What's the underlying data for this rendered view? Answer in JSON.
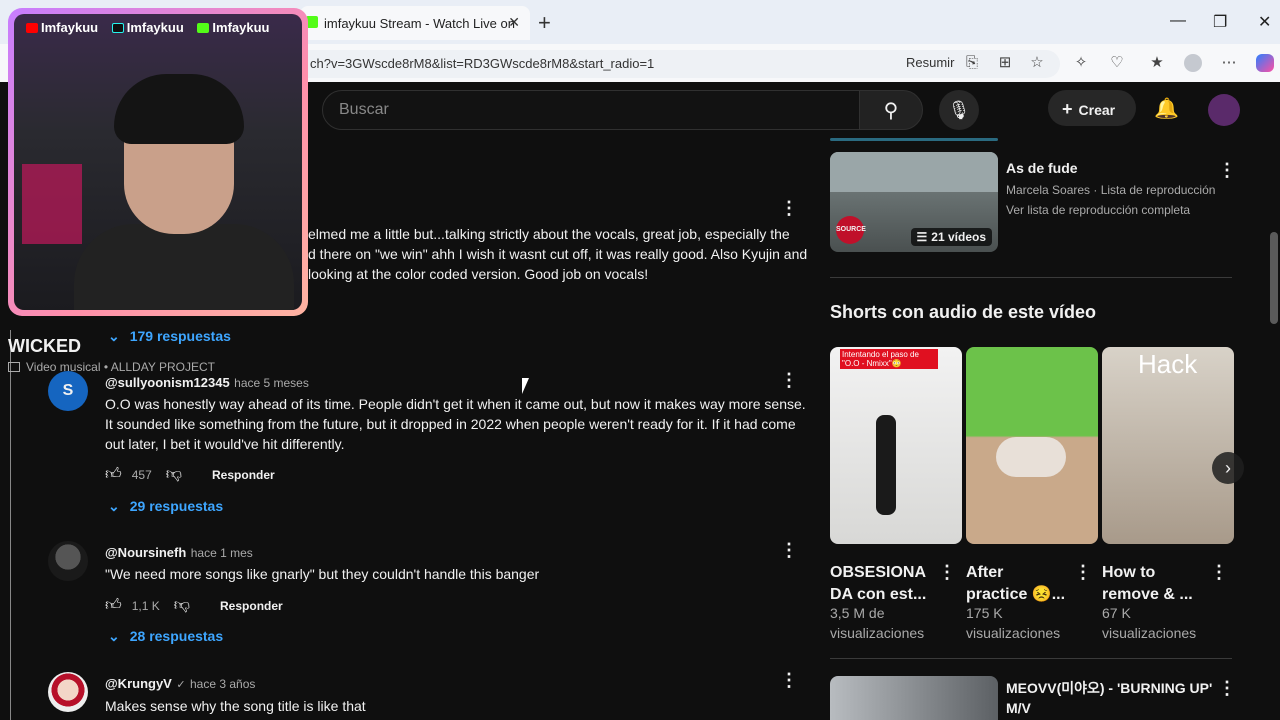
{
  "browser": {
    "tab_title": "imfaykuu Stream - Watch Live on",
    "url": "ch?v=3GWscde8rM8&list=RD3GWscde8rM8&start_radio=1",
    "resumir": "Resumir"
  },
  "overlay": {
    "handles": [
      "Imfaykuu",
      "Imfaykuu",
      "Imfaykuu"
    ],
    "video_title": "WICKED",
    "video_sub": "Video musical • ALLDAY PROJECT"
  },
  "header": {
    "search_placeholder": "Buscar",
    "create": "Crear"
  },
  "comments": [
    {
      "lines": [
        "elmed me a little but...talking strictly about the vocals, great job, especially the",
        "d there on \"we win\" ahh I wish it wasnt cut off, it was really good. Also Kyujin and",
        "looking at the color coded version. Good job on vocals!"
      ],
      "replies": "179 respuestas"
    },
    {
      "author": "@sullyoonism12345",
      "time": "hace 5 meses",
      "avatar_letter": "S",
      "lines": [
        "O.O was honestly way ahead of its time. People didn't get it when it came out, but now it makes way more sense.",
        "It sounded like something from the future, but it dropped in 2022 when people weren't ready for it. If it had come",
        "out later, I bet it would've hit differently."
      ],
      "likes": "457",
      "reply_btn": "Responder",
      "replies": "29 respuestas"
    },
    {
      "author": "@Noursinefh",
      "time": "hace 1 mes",
      "lines": [
        "\"We need more songs like gnarly\" but they couldn't handle this banger"
      ],
      "likes": "1,1 K",
      "reply_btn": "Responder",
      "replies": "28 respuestas"
    },
    {
      "author": "@KrungyV",
      "time": "hace 3 años",
      "lines": [
        "Makes sense why the song title is like that"
      ]
    }
  ],
  "sidebar": {
    "playlist": {
      "title": "As de fude",
      "channel": "Marcela Soares · Lista de reproducción",
      "link": "Ver lista de reproducción completa",
      "count": "21 vídeos",
      "thumb_badge": "SOURCE MUSIC"
    },
    "shorts_heading": "Shorts con audio de este vídeo",
    "shorts": [
      {
        "title_l1": "OBSESIONA",
        "title_l2": "DA con est...",
        "views_l1": "3,5 M de",
        "views_l2": "visualizaciones",
        "overlay": "Intentando el paso de \"O.O - Nmixx\"😳"
      },
      {
        "title_l1": "After",
        "title_l2": "practice 😣...",
        "views_l1": "175 K",
        "views_l2": "visualizaciones",
        "overlay": ""
      },
      {
        "title_l1": "How to",
        "title_l2": "remove & ...",
        "views_l1": "67 K",
        "views_l2": "visualizaciones",
        "overlay": "Hack"
      }
    ],
    "next_video": {
      "title_l1": "MEOVV(미야오) - 'BURNING UP'",
      "title_l2": "M/V"
    }
  }
}
